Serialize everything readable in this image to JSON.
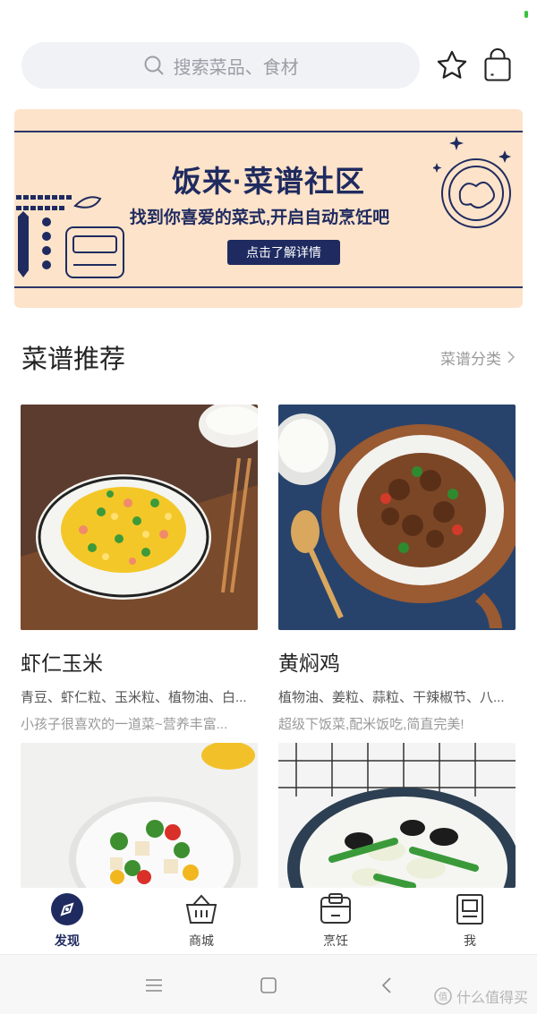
{
  "search": {
    "placeholder": "搜索菜品、食材"
  },
  "banner": {
    "title": "饭来·菜谱社区",
    "subtitle": "找到你喜爱的菜式,开启自动烹饪吧",
    "button_label": "点击了解详情"
  },
  "section": {
    "title": "菜谱推荐",
    "link_label": "菜谱分类"
  },
  "recipes": [
    {
      "name": "虾仁玉米",
      "ingredients": "青豆、虾仁粒、玉米粒、植物油、白...",
      "description": "小孩子很喜欢的一道菜~营养丰富..."
    },
    {
      "name": "黄焖鸡",
      "ingredients": "植物油、姜粒、蒜粒、干辣椒节、八...",
      "description": "超级下饭菜,配米饭吃,简直完美!"
    },
    {
      "name": "",
      "ingredients": "",
      "description": ""
    },
    {
      "name": "",
      "ingredients": "",
      "description": ""
    }
  ],
  "nav": [
    {
      "label": "发现",
      "icon": "compass-icon",
      "active": true
    },
    {
      "label": "商城",
      "icon": "basket-icon",
      "active": false
    },
    {
      "label": "烹饪",
      "icon": "cooker-icon",
      "active": false
    },
    {
      "label": "我",
      "icon": "profile-icon",
      "active": false
    }
  ],
  "watermark": "什么值得买",
  "colors": {
    "brand": "#1f2b60",
    "banner_bg": "#fde3c9",
    "search_bg": "#f0f2f5",
    "status_green": "#38c23a"
  }
}
